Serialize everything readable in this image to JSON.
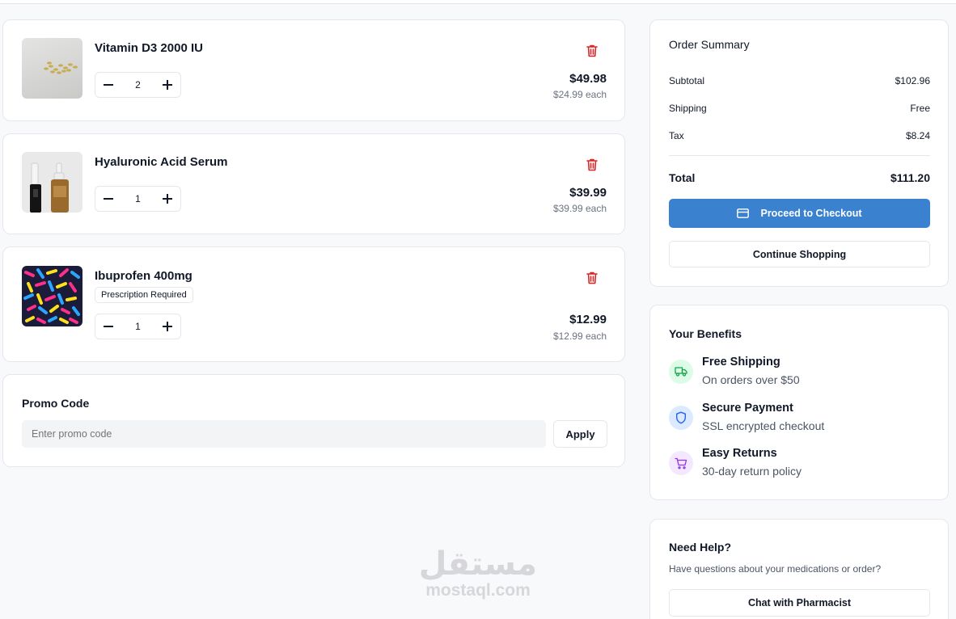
{
  "cart": {
    "items": [
      {
        "name": "Vitamin D3 2000 IU",
        "qty": "2",
        "total": "$49.98",
        "each": "$24.99 each"
      },
      {
        "name": "Hyaluronic Acid Serum",
        "qty": "1",
        "total": "$39.99",
        "each": "$39.99 each"
      },
      {
        "name": "Ibuprofen 400mg",
        "badge": "Prescription Required",
        "qty": "1",
        "total": "$12.99",
        "each": "$12.99 each"
      }
    ]
  },
  "promo": {
    "title": "Promo Code",
    "placeholder": "Enter promo code",
    "apply_label": "Apply"
  },
  "summary": {
    "title": "Order Summary",
    "subtotal_label": "Subtotal",
    "subtotal_value": "$102.96",
    "shipping_label": "Shipping",
    "shipping_value": "Free",
    "tax_label": "Tax",
    "tax_value": "$8.24",
    "total_label": "Total",
    "total_value": "$111.20",
    "checkout_label": "Proceed to Checkout",
    "continue_label": "Continue Shopping"
  },
  "benefits": {
    "title": "Your Benefits",
    "items": [
      {
        "title": "Free Shipping",
        "subtitle": "On orders over $50",
        "icon": "truck-icon",
        "color": "#16a34a",
        "bg": "#dcfce7"
      },
      {
        "title": "Secure Payment",
        "subtitle": "SSL encrypted checkout",
        "icon": "shield-icon",
        "color": "#2563eb",
        "bg": "#dbeafe"
      },
      {
        "title": "Easy Returns",
        "subtitle": "30-day return policy",
        "icon": "cart-icon",
        "color": "#9333ea",
        "bg": "#f3e8ff"
      }
    ]
  },
  "help": {
    "title": "Need Help?",
    "subtitle": "Have questions about your medications or order?",
    "chat_label": "Chat with Pharmacist"
  },
  "watermark": {
    "arabic": "مستقل",
    "latin": "mostaql.com"
  },
  "colors": {
    "accent": "#3a82cf",
    "danger": "#dc2626"
  }
}
